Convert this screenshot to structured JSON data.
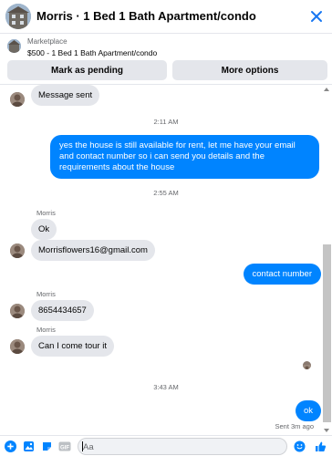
{
  "header": {
    "title": "Morris · 1 Bed 1 Bath Apartment/condo"
  },
  "listing": {
    "source": "Marketplace",
    "price_title": "$500 - 1 Bed 1 Bath Apartment/condo"
  },
  "actions": {
    "pending_label": "Mark as pending",
    "more_label": "More options"
  },
  "messages": {
    "m1": "Message sent",
    "ts1": "2:11 AM",
    "m2": "yes the house is still available for rent, let me have your email  and contact number so i can send you details and the requirements about the house",
    "ts2": "2:55 AM",
    "sender1": "Morris",
    "m3": "Ok",
    "m4": "Morrisflowers16@gmail.com",
    "m5": "contact number",
    "sender2": "Morris",
    "m6": "8654434657",
    "sender3": "Morris",
    "m7": "Can I come tour it",
    "ts3": "3:43 AM",
    "m8": "ok",
    "status": "Sent 3m ago"
  },
  "composer": {
    "placeholder": "Aa"
  },
  "colors": {
    "accent": "#0084ff",
    "bubble_in": "#e4e6eb"
  }
}
